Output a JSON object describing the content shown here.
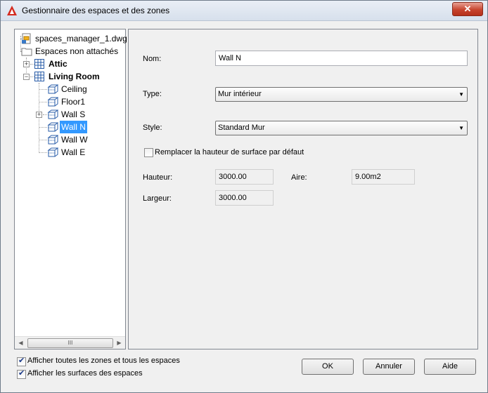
{
  "window": {
    "title": "Gestionnaire des espaces et des zones"
  },
  "tree": {
    "root": "spaces_manager_1.dwg",
    "unattached": "Espaces non attachés",
    "attic": "Attic",
    "living_room": "Living Room",
    "ceiling": "Ceiling",
    "floor1": "Floor1",
    "wall_s": "Wall S",
    "wall_n": "Wall N",
    "wall_w": "Wall W",
    "wall_e": "Wall E"
  },
  "scrollbar": {
    "thumb": "III"
  },
  "props": {
    "nom_label": "Nom:",
    "nom_value": "Wall N",
    "type_label": "Type:",
    "type_value": "Mur intérieur",
    "style_label": "Style:",
    "style_value": "Standard Mur",
    "override_label": "Remplacer la hauteur de surface par défaut",
    "override_checked": false,
    "hauteur_label": "Hauteur:",
    "hauteur_value": "3000.00",
    "aire_label": "Aire:",
    "aire_value": "9.00m2",
    "largeur_label": "Largeur:",
    "largeur_value": "3000.00"
  },
  "footer": {
    "show_all_label": "Afficher toutes les zones et tous les espaces",
    "show_all_checked": true,
    "show_surfaces_label": "Afficher les surfaces des espaces",
    "show_surfaces_checked": true,
    "ok": "OK",
    "cancel": "Annuler",
    "help": "Aide"
  },
  "icons": {
    "app": "autocad-logo-icon",
    "close": "close-icon",
    "drawing": "drawing-file-icon",
    "folder": "folder-icon",
    "zone": "zone-icon",
    "space": "space-icon",
    "surface": "surface-icon"
  },
  "colors": {
    "selection": "#3399ff",
    "close": "#c7442e",
    "accent": "#d42a1e"
  }
}
